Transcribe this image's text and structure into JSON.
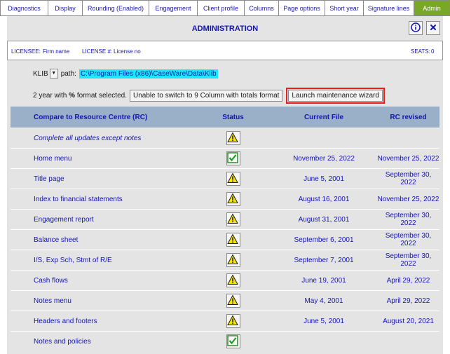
{
  "tabs": [
    {
      "label": "Diagnostics",
      "w": 69
    },
    {
      "label": "Display",
      "w": 49
    },
    {
      "label": "Rounding (Enabled)",
      "w": 95
    },
    {
      "label": "Engagement",
      "w": 69
    },
    {
      "label": "Client profile",
      "w": 67
    },
    {
      "label": "Columns",
      "w": 49
    },
    {
      "label": "Page options",
      "w": 66
    },
    {
      "label": "Short year",
      "w": 55
    },
    {
      "label": "Signature lines",
      "w": 72
    },
    {
      "label": "Admin",
      "w": 51,
      "active": true
    }
  ],
  "header": {
    "title": "ADMINISTRATION"
  },
  "licensee": {
    "licensee_label": "LICENSEE:",
    "licensee_value": "Firm name",
    "license_no_label": "LICENSE #:",
    "license_no_value": "License no",
    "seats_label": "SEATS:",
    "seats_value": "0"
  },
  "klib": {
    "label": "KLIB",
    "path_label": "path:",
    "path_value": "C:\\Program Files (x86)\\CaseWare\\Data\\Klib"
  },
  "format": {
    "text_part1": "2 year with",
    "percent": "%",
    "text_part2": "format selected.",
    "switch_button": "Unable to switch to 9 Column with totals format",
    "wizard_button": "Launch maintenance wizard"
  },
  "table": {
    "headers": [
      "Compare to Resource Centre (RC)",
      "Status",
      "Current File",
      "RC revised"
    ],
    "rows": [
      {
        "name": "Complete all updates except notes",
        "status": "warning",
        "current": "",
        "revised": "",
        "italic": true
      },
      {
        "name": "Home menu",
        "status": "ok",
        "current": "November 25, 2022",
        "revised": "November 25, 2022"
      },
      {
        "name": "Title page",
        "status": "warning",
        "current": "June 5, 2001",
        "revised": "September 30, 2022"
      },
      {
        "name": "Index to financial statements",
        "status": "warning",
        "current": "August 16, 2001",
        "revised": "November 25, 2022"
      },
      {
        "name": "Engagement report",
        "status": "warning",
        "current": "August 31, 2001",
        "revised": "September 30, 2022"
      },
      {
        "name": "Balance sheet",
        "status": "warning",
        "current": "September 6, 2001",
        "revised": "September 30, 2022"
      },
      {
        "name": "I/S, Exp Sch, Stmt of R/E",
        "status": "warning",
        "current": "September 7, 2001",
        "revised": "September 30, 2022"
      },
      {
        "name": "Cash flows",
        "status": "warning",
        "current": "June 19, 2001",
        "revised": "April 29, 2022"
      },
      {
        "name": "Notes menu",
        "status": "warning",
        "current": "May 4, 2001",
        "revised": "April 29, 2022"
      },
      {
        "name": "Headers and footers",
        "status": "warning",
        "current": "June 5, 2001",
        "revised": "August 20, 2021"
      },
      {
        "name": "Notes and policies",
        "status": "ok",
        "current": "",
        "revised": ""
      }
    ]
  },
  "colors": {
    "accent": "#79a826",
    "title": "#1414b4",
    "header_bg": "#9ab0c8",
    "panel_bg": "#e4e4e4",
    "highlight": "#e61e1e",
    "path_bg": "#20e6ff"
  }
}
